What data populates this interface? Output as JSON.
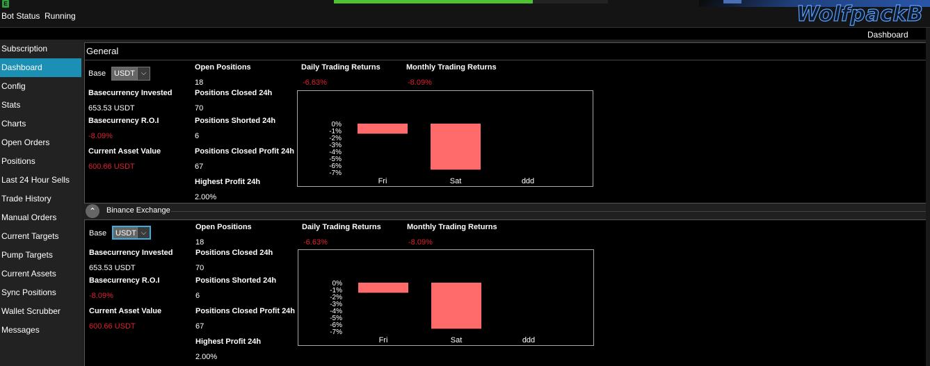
{
  "topbar": {
    "app_icon": "E",
    "bot_status_label": "Bot Status",
    "bot_status_value": "Running",
    "progress_fraction": 0.725,
    "logo_text": "WolfpackB",
    "page_title": "Dashboard"
  },
  "colors": {
    "accent": "#1b8fb4",
    "negative": "#e02030",
    "bar": "#ff6b6b",
    "progress": "#4ec432"
  },
  "sidebar": {
    "items": [
      {
        "label": "Subscription"
      },
      {
        "label": "Dashboard",
        "active": true
      },
      {
        "label": "Config"
      },
      {
        "label": "Stats"
      },
      {
        "label": "Charts"
      },
      {
        "label": "Open Orders"
      },
      {
        "label": "Positions"
      },
      {
        "label": "Last 24 Hour Sells"
      },
      {
        "label": "Trade History"
      },
      {
        "label": "Manual Orders"
      },
      {
        "label": "Current Targets"
      },
      {
        "label": "Pump Targets"
      },
      {
        "label": "Current Assets"
      },
      {
        "label": "Sync Positions"
      },
      {
        "label": "Wallet Scrubber"
      },
      {
        "label": "Messages"
      }
    ]
  },
  "general": {
    "title": "General",
    "base_label": "Base",
    "base_value": "USDT",
    "basecurrency_invested_label": "Basecurrency Invested",
    "basecurrency_invested": "653.53 USDT",
    "roi_label": "Basecurrency R.O.I",
    "roi": "-8.09%",
    "asset_value_label": "Current Asset Value",
    "asset_value": "600.66 USDT",
    "open_positions_label": "Open Positions",
    "open_positions": "18",
    "closed_24h_label": "Positions Closed 24h",
    "closed_24h": "70",
    "shorted_24h_label": "Positions Shorted 24h",
    "shorted_24h": "6",
    "closed_profit_label": "Positions Closed Profit 24h",
    "closed_profit": "67",
    "highest_profit_label": "Highest Profit 24h",
    "highest_profit": "2.00%",
    "daily_returns_label": "Daily Trading Returns",
    "daily_returns": "-6.63%",
    "monthly_returns_label": "Monthly Trading Returns",
    "monthly_returns": "-8.09%"
  },
  "group": {
    "label": "Binance Exchange",
    "collapse_icon": "chevron-up-icon"
  },
  "exchange": {
    "base_label": "Base",
    "base_value": "USDT",
    "basecurrency_invested_label": "Basecurrency Invested",
    "basecurrency_invested": "653.53 USDT",
    "roi_label": "Basecurrency R.O.I",
    "roi": "-8.09%",
    "asset_value_label": "Current Asset Value",
    "asset_value": "600.66 USDT",
    "open_positions_label": "Open Positions",
    "open_positions": "18",
    "closed_24h_label": "Positions Closed 24h",
    "closed_24h": "70",
    "shorted_24h_label": "Positions Shorted 24h",
    "shorted_24h": "6",
    "closed_profit_label": "Positions Closed Profit 24h",
    "closed_profit": "67",
    "highest_profit_label": "Highest Profit 24h",
    "highest_profit": "2.00%",
    "daily_returns_label": "Daily Trading Returns",
    "daily_returns": "-6.63%",
    "monthly_returns_label": "Monthly Trading Returns",
    "monthly_returns": "-8.09%"
  },
  "chart_data": [
    {
      "type": "bar",
      "categories": [
        "Fri",
        "Sat",
        "ddd"
      ],
      "values": [
        -1.45,
        -6.63,
        null
      ],
      "y_ticks": [
        "0%",
        "-1%",
        "-2%",
        "-3%",
        "-4%",
        "-5%",
        "-6%",
        "-7%"
      ],
      "ylim": [
        -7,
        0
      ],
      "grid": false,
      "title": "",
      "xlabel": "",
      "ylabel": ""
    },
    {
      "type": "bar",
      "categories": [
        "Fri",
        "Sat",
        "ddd"
      ],
      "values": [
        -1.45,
        -6.63,
        null
      ],
      "y_ticks": [
        "0%",
        "-1%",
        "-2%",
        "-3%",
        "-4%",
        "-5%",
        "-6%",
        "-7%"
      ],
      "ylim": [
        -7,
        0
      ],
      "grid": false,
      "title": "",
      "xlabel": "",
      "ylabel": ""
    }
  ]
}
